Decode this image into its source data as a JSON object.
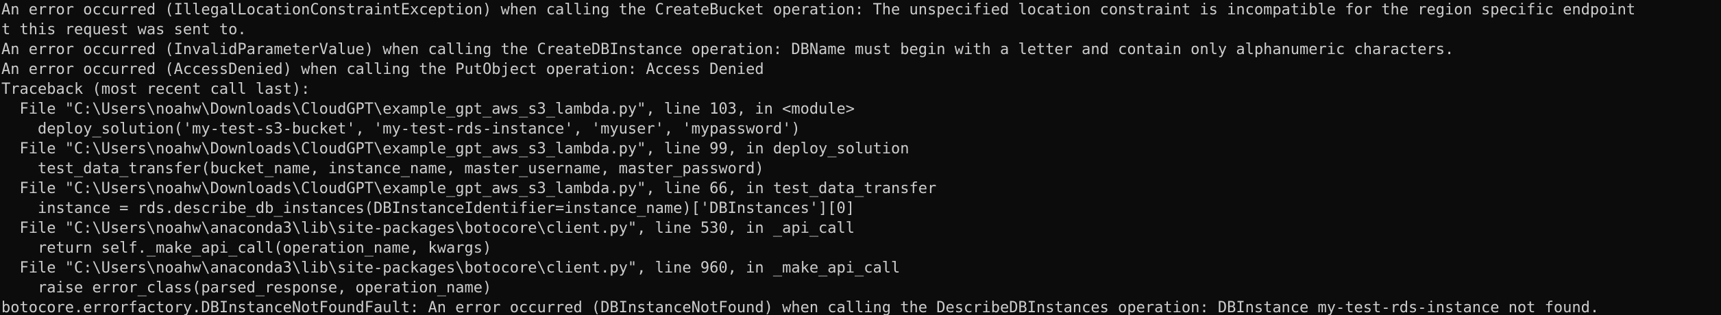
{
  "terminal": {
    "lines": [
      "An error occurred (IllegalLocationConstraintException) when calling the CreateBucket operation: The unspecified location constraint is incompatible for the region specific endpoint",
      "t this request was sent to.",
      "An error occurred (InvalidParameterValue) when calling the CreateDBInstance operation: DBName must begin with a letter and contain only alphanumeric characters.",
      "An error occurred (AccessDenied) when calling the PutObject operation: Access Denied",
      "Traceback (most recent call last):",
      "  File \"C:\\Users\\noahw\\Downloads\\CloudGPT\\example_gpt_aws_s3_lambda.py\", line 103, in <module>",
      "    deploy_solution('my-test-s3-bucket', 'my-test-rds-instance', 'myuser', 'mypassword')",
      "  File \"C:\\Users\\noahw\\Downloads\\CloudGPT\\example_gpt_aws_s3_lambda.py\", line 99, in deploy_solution",
      "    test_data_transfer(bucket_name, instance_name, master_username, master_password)",
      "  File \"C:\\Users\\noahw\\Downloads\\CloudGPT\\example_gpt_aws_s3_lambda.py\", line 66, in test_data_transfer",
      "    instance = rds.describe_db_instances(DBInstanceIdentifier=instance_name)['DBInstances'][0]",
      "  File \"C:\\Users\\noahw\\anaconda3\\lib\\site-packages\\botocore\\client.py\", line 530, in _api_call",
      "    return self._make_api_call(operation_name, kwargs)",
      "  File \"C:\\Users\\noahw\\anaconda3\\lib\\site-packages\\botocore\\client.py\", line 960, in _make_api_call",
      "    raise error_class(parsed_response, operation_name)",
      "botocore.errorfactory.DBInstanceNotFoundFault: An error occurred (DBInstanceNotFound) when calling the DescribeDBInstances operation: DBInstance my-test-rds-instance not found."
    ]
  },
  "colors": {
    "background": "#0c0c0c",
    "foreground": "#cccccc"
  }
}
